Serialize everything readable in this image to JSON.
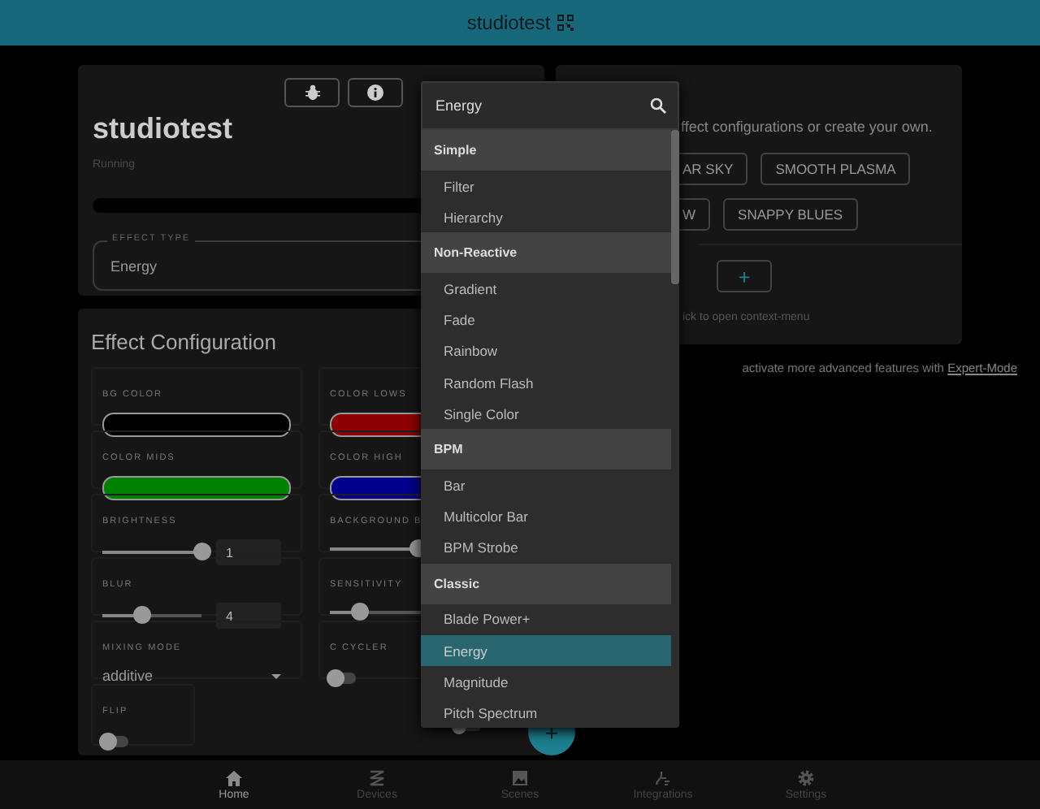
{
  "top_bar": {
    "title": "studiotest"
  },
  "device": {
    "title": "studiotest",
    "status": "Running",
    "effect_type": {
      "label": "EFFECT TYPE",
      "value": "Energy"
    }
  },
  "presets": {
    "description": "ffect configurations or create your own.",
    "rows": [
      [
        "AR SKY",
        "SMOOTH PLASMA"
      ],
      [
        "W",
        "SNAPPY BLUES"
      ]
    ],
    "add_button": "+",
    "hint": "ick to open context-menu"
  },
  "footer_note": {
    "text": "activate more advanced features with",
    "link": "Expert-Mode"
  },
  "config": {
    "title": "Effect Configuration",
    "fields": [
      {
        "kind": "color",
        "label": "BG COLOR",
        "color": "#000000"
      },
      {
        "kind": "color",
        "label": "COLOR LOWS",
        "color": "#8b0000"
      },
      {
        "kind": "color",
        "label": "COLOR MIDS",
        "color": "#008000"
      },
      {
        "kind": "color",
        "label": "COLOR HIGH",
        "color": "#00008b"
      },
      {
        "kind": "slider",
        "label": "BRIGHTNESS",
        "level": 1,
        "value": "1"
      },
      {
        "kind": "slider",
        "label": "BACKGROUND B",
        "level": 0.9
      },
      {
        "kind": "slider",
        "label": "BLUR",
        "level": 0.4,
        "value": "4"
      },
      {
        "kind": "slider",
        "label": "SENSITIVITY",
        "level": 0.3
      },
      {
        "kind": "select",
        "label": "MIXING MODE",
        "value": "additive"
      },
      {
        "kind": "toggle",
        "label": "C CYCLER",
        "on": false
      },
      {
        "kind": "toggle",
        "label": "FLIP",
        "on": false
      },
      {
        "kind": "toggle",
        "on": false
      }
    ]
  },
  "fab": "+",
  "dropdown": {
    "search": {
      "value": "Energy"
    },
    "groups": [
      {
        "label": "Simple",
        "items": [
          {
            "label": "Filter",
            "selected": false
          },
          {
            "label": "Hierarchy",
            "selected": false
          }
        ]
      },
      {
        "label": "Non-Reactive",
        "items": [
          {
            "label": "Gradient",
            "selected": false
          },
          {
            "label": "Fade",
            "selected": false
          },
          {
            "label": "Rainbow",
            "selected": false
          },
          {
            "label": "Random Flash",
            "selected": false
          },
          {
            "label": "Single Color",
            "selected": false
          }
        ]
      },
      {
        "label": "BPM",
        "items": [
          {
            "label": "Bar",
            "selected": false
          },
          {
            "label": "Multicolor Bar",
            "selected": false
          },
          {
            "label": "BPM Strobe",
            "selected": false
          }
        ]
      },
      {
        "label": "Classic",
        "items": [
          {
            "label": "Blade Power+",
            "selected": false
          },
          {
            "label": "Energy",
            "selected": true
          },
          {
            "label": "Magnitude",
            "selected": false
          },
          {
            "label": "Pitch Spectrum",
            "selected": false
          }
        ]
      }
    ]
  },
  "nav": [
    {
      "label": "Home",
      "selected": true
    },
    {
      "label": "Devices",
      "selected": false
    },
    {
      "label": "Scenes",
      "selected": false
    },
    {
      "label": "Integrations",
      "selected": false
    },
    {
      "label": "Settings",
      "selected": false
    }
  ]
}
